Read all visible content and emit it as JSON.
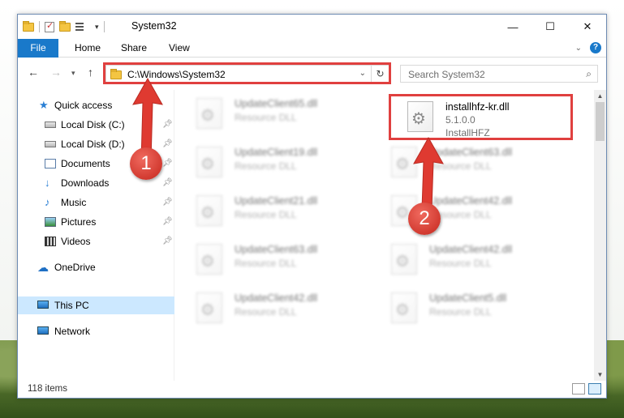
{
  "window": {
    "title": "System32",
    "controls": {
      "minimize": "—",
      "maximize": "☐",
      "close": "✕"
    }
  },
  "ribbon": {
    "tabs": [
      {
        "label": "File"
      },
      {
        "label": "Home"
      },
      {
        "label": "Share"
      },
      {
        "label": "View"
      }
    ]
  },
  "navigation": {
    "address": "C:\\Windows\\System32",
    "search_placeholder": "Search System32"
  },
  "sidebar": {
    "items": [
      {
        "label": "Quick access"
      },
      {
        "label": "Local Disk (C:)"
      },
      {
        "label": "Local Disk (D:)"
      },
      {
        "label": "Documents"
      },
      {
        "label": "Downloads"
      },
      {
        "label": "Music"
      },
      {
        "label": "Pictures"
      },
      {
        "label": "Videos"
      },
      {
        "label": "OneDrive"
      },
      {
        "label": "This PC"
      },
      {
        "label": "Network"
      }
    ]
  },
  "files": [
    {
      "name": "UpdateClient65.dll",
      "desc": "Resource DLL"
    },
    {
      "name": "UpdateClient19.dll",
      "desc": "Resource DLL"
    },
    {
      "name": "UpdateClient21.dll",
      "desc": "Resource DLL"
    },
    {
      "name": "UpdateClient63.dll",
      "desc": "Resource DLL"
    },
    {
      "name": "UpdateClient42.dll",
      "desc": "Resource DLL"
    },
    {
      "name": "UpdateClient63.dll",
      "desc": "Resource DLL"
    },
    {
      "name": "UpdateClient42.dll",
      "desc": "Resource DLL"
    },
    {
      "name": "UpdateClient42.dll",
      "desc": "Resource DLL"
    },
    {
      "name": "UpdateClient5.dll",
      "desc": "Resource DLL"
    }
  ],
  "highlighted_file": {
    "name": "installhfz-kr.dll",
    "version": "5.1.0.0",
    "company": "InstallHFZ"
  },
  "status": {
    "item_count": "118 items"
  },
  "callouts": {
    "one": "1",
    "two": "2"
  },
  "colors": {
    "accent": "#1979ca",
    "highlight": "#e0403f",
    "selected": "#cce8ff"
  }
}
